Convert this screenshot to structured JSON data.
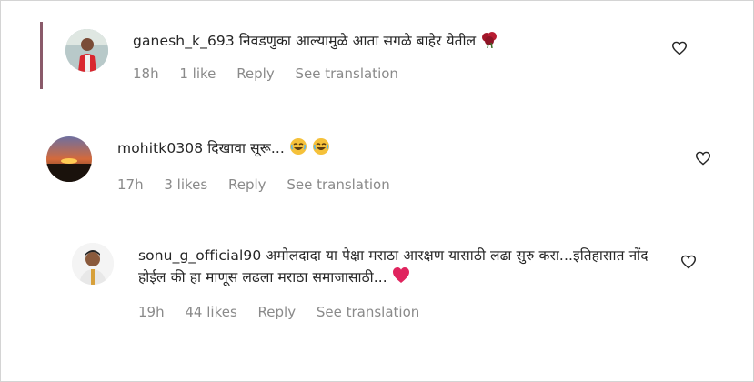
{
  "comments": [
    {
      "username": "ganesh_k_693",
      "text": "निवडणुका आल्यामुळे आता सगळे बाहेर येतील",
      "time": "18h",
      "likes": "1 like",
      "reply": "Reply",
      "translation": "See translation"
    },
    {
      "username": "mohitk0308",
      "text": "दिखावा सूरू...",
      "time": "17h",
      "likes": "3 likes",
      "reply": "Reply",
      "translation": "See translation"
    },
    {
      "username": "sonu_g_official90",
      "text": "अमोलदादा या पेक्षा मराठा आरक्षण यासाठी लढा सुरु करा...इतिहासात नोंद होईल की हा माणूस लढला मराठा समाजासाठी...",
      "time": "19h",
      "likes": "44 likes",
      "reply": "Reply",
      "translation": "See translation"
    }
  ],
  "icons": {
    "like": "heart-outline-icon",
    "flower": "rose-emoji",
    "laugh": "grinning-emoji",
    "love": "red-heart-emoji"
  },
  "colors": {
    "text": "#262626",
    "meta": "#8a8a8a",
    "thread_bar": "#8a5a6a",
    "heart_emoji": "#e0245e"
  }
}
